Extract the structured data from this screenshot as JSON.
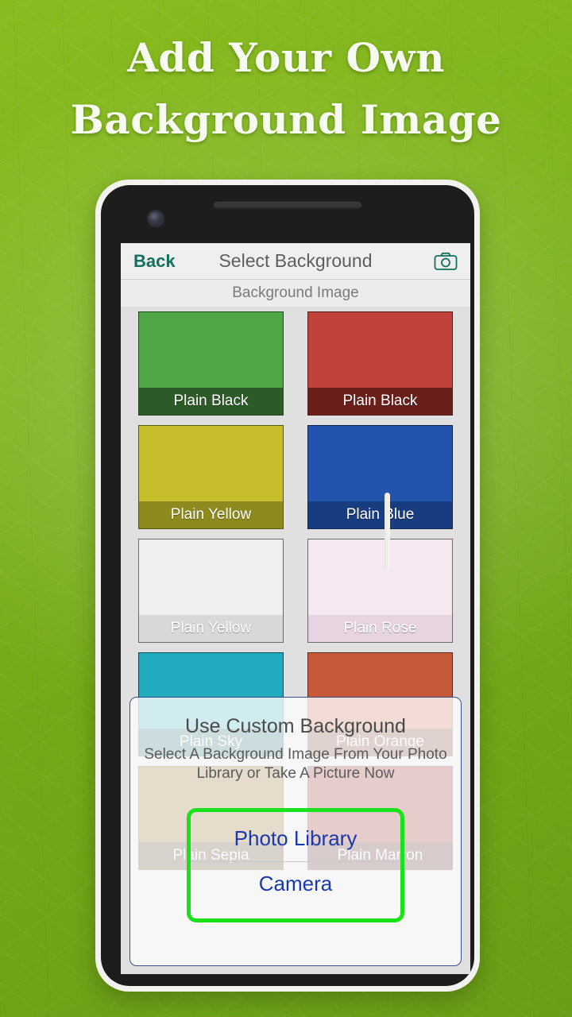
{
  "promo": {
    "headline_line1": "Add Your Own",
    "headline_line2": "Background Image"
  },
  "app": {
    "navbar": {
      "back_label": "Back",
      "title": "Select Background",
      "camera_icon": "camera-icon"
    },
    "section_header": "Background Image",
    "tiles": [
      {
        "label": "Plain Black",
        "swatch_color": "#4fa747",
        "label_bar_color": "#2d5b28"
      },
      {
        "label": "Plain Black",
        "swatch_color": "#c1413b",
        "label_bar_color": "#6a1f1b"
      },
      {
        "label": "Plain Yellow",
        "swatch_color": "#c6bf2b",
        "label_bar_color": "#8d8a1e"
      },
      {
        "label": "Plain Blue",
        "swatch_color": "#2254ae",
        "label_bar_color": "#173c80"
      },
      {
        "label": "Plain Yellow",
        "swatch_color": "#efefef",
        "label_bar_color": "#d8d8d8"
      },
      {
        "label": "Plain Rose",
        "swatch_color": "#f5e8f0",
        "label_bar_color": "#e7d4e0"
      },
      {
        "label": "Plain Sky",
        "swatch_color": "#1fabbd",
        "label_bar_color": "#0e5f6b"
      },
      {
        "label": "Plain Orange",
        "swatch_color": "#c65a38",
        "label_bar_color": "#70301c"
      },
      {
        "label": "Plain Sepia",
        "swatch_color": "#8c5c07",
        "label_bar_color": "#402c08"
      },
      {
        "label": "Plain Marron",
        "swatch_color": "#8a110c",
        "label_bar_color": "#440a08"
      }
    ],
    "dialog": {
      "title": "Use Custom Background",
      "message": "Select A Background Image From Your Photo Library or Take A Picture Now",
      "photo_library_label": "Photo Library",
      "camera_label": "Camera",
      "focus_color": "#1ae21a",
      "button_text_color": "#1a39ad"
    }
  },
  "colors": {
    "background_green": "#7fb31c",
    "accent_teal": "#12705c",
    "nav_title_gray": "#5e5e5e"
  }
}
